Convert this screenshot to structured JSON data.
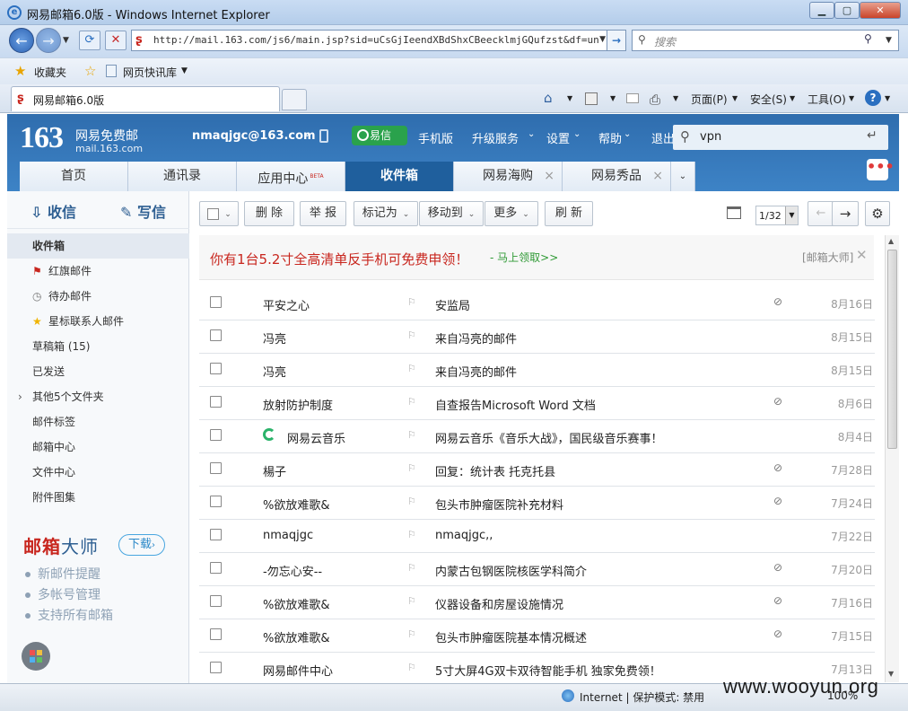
{
  "browser": {
    "window_title": "网易邮箱6.0版 - Windows Internet Explorer",
    "url": "http://mail.163.com/js6/main.jsp?sid=uCsGjIeendXBdShxCBeecklmjGQufzst&df=un",
    "search_placeholder": "搜索",
    "favorites_label": "收藏夹",
    "quicklib_label": "网页快讯库",
    "tab_title": "网易邮箱6.0版",
    "menu_page": "页面(P)",
    "menu_safety": "安全(S)",
    "menu_tools": "工具(O)",
    "help_icon": "?",
    "status_zone": "Internet | 保护模式: 禁用",
    "zoom": "100%"
  },
  "header": {
    "logo_num": "163",
    "logo_name": "网易免费邮",
    "logo_domain": "mail.163.com",
    "account": "nmaqjgc@163.com",
    "yixin": "易信",
    "links": [
      "手机版",
      "升级服务",
      "设置",
      "帮助",
      "退出"
    ],
    "search_value": "vpn"
  },
  "tabs": [
    {
      "label": "首页"
    },
    {
      "label": "通讯录"
    },
    {
      "label": "应用中心",
      "badge": "BETA"
    },
    {
      "label": "收件箱"
    },
    {
      "label": "网易海购"
    },
    {
      "label": "网易秀品"
    }
  ],
  "sidebar": {
    "receive": "收信",
    "write": "写信",
    "folders": [
      "收件箱",
      "红旗邮件",
      "待办邮件",
      "星标联系人邮件",
      "草稿箱 (15)",
      "已发送",
      "其他5个文件夹",
      "邮件标签",
      "邮箱中心",
      "文件中心",
      "附件图集"
    ],
    "promo_title_a": "邮箱",
    "promo_title_b": "大师",
    "promo_download": "下载",
    "promo_items": [
      "新邮件提醒",
      "多帐号管理",
      "支持所有邮箱"
    ]
  },
  "toolbar": {
    "delete": "删 除",
    "report": "举 报",
    "mark": "标记为",
    "move": "移动到",
    "more": "更多",
    "refresh": "刷 新",
    "page": "1/32"
  },
  "banner": {
    "text": "你有1台5.2寸全高清单反手机可免费申领！",
    "link": "- 马上领取>>",
    "source": "[邮箱大师]"
  },
  "mails": [
    {
      "from": "平安之心",
      "subject": "安监局",
      "attach": true,
      "date": "8月16日"
    },
    {
      "from": "冯亮",
      "subject": "来自冯亮的邮件",
      "attach": false,
      "date": "8月15日"
    },
    {
      "from": "冯亮",
      "subject": "来自冯亮的邮件",
      "attach": false,
      "date": "8月15日"
    },
    {
      "from": "放射防护制度",
      "subject": "自查报告Microsoft Word 文档",
      "attach": true,
      "date": "8月6日"
    },
    {
      "from": "网易云音乐",
      "subject": "网易云音乐《音乐大战》，国民级音乐赛事！",
      "attach": false,
      "date": "8月4日"
    },
    {
      "from": "楊子",
      "subject": "回复：统计表 托克托县",
      "attach": true,
      "date": "7月28日"
    },
    {
      "from": "%欲放难歌&",
      "subject": "包头市肿瘤医院补充材料",
      "attach": true,
      "date": "7月24日"
    },
    {
      "from": "nmaqjgc",
      "subject": "nmaqjgc,,",
      "attach": false,
      "date": "7月22日"
    },
    {
      "from": "-勿忘心安--",
      "subject": "内蒙古包钢医院核医学科简介",
      "attach": true,
      "date": "7月20日"
    },
    {
      "from": "%欲放难歌&",
      "subject": "仪器设备和房屋设施情况",
      "attach": true,
      "date": "7月16日"
    },
    {
      "from": "%欲放难歌&",
      "subject": "包头市肿瘤医院基本情况概述",
      "attach": true,
      "date": "7月15日"
    },
    {
      "from": "网易邮件中心",
      "subject": "5寸大屏4G双卡双待智能手机 独家免费领！",
      "attach": false,
      "date": "7月13日"
    }
  ],
  "watermark": "www.wooyun.org"
}
